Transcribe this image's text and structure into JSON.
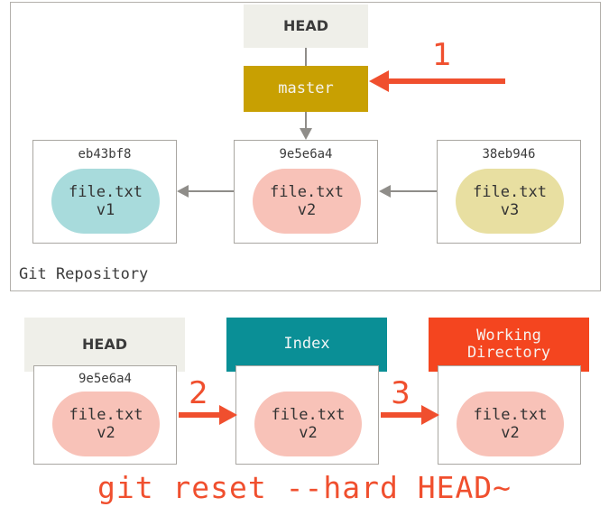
{
  "repository": {
    "label": "Git Repository",
    "pointers": {
      "head_label": "HEAD",
      "branch_label": "master"
    },
    "commits": [
      {
        "sha": "eb43bf8",
        "file": "file.txt",
        "version": "v1",
        "blob_color": "#a8dbdc"
      },
      {
        "sha": "9e5e6a4",
        "file": "file.txt",
        "version": "v2",
        "blob_color": "#f8c2b8"
      },
      {
        "sha": "38eb946",
        "file": "file.txt",
        "version": "v3",
        "blob_color": "#e8dfa1"
      }
    ]
  },
  "areas": {
    "head": {
      "title": "HEAD",
      "sha": "9e5e6a4",
      "file": "file.txt",
      "version": "v2",
      "header_color": "#efefe9"
    },
    "index": {
      "title": "Index",
      "file": "file.txt",
      "version": "v2",
      "header_color": "#0a8f96"
    },
    "working_directory": {
      "title_line1": "Working",
      "title_line2": "Directory",
      "file": "file.txt",
      "version": "v2",
      "header_color": "#f4451f"
    }
  },
  "steps": {
    "one": "1",
    "two": "2",
    "three": "3"
  },
  "command": "git reset --hard HEAD~",
  "colors": {
    "accent_red": "#f04f2e",
    "branch_gold": "#c8a002",
    "teal": "#0a8f96",
    "orange": "#f4451f",
    "connector_gray": "#8f8d89",
    "frame_gray": "#b3b0ab"
  }
}
